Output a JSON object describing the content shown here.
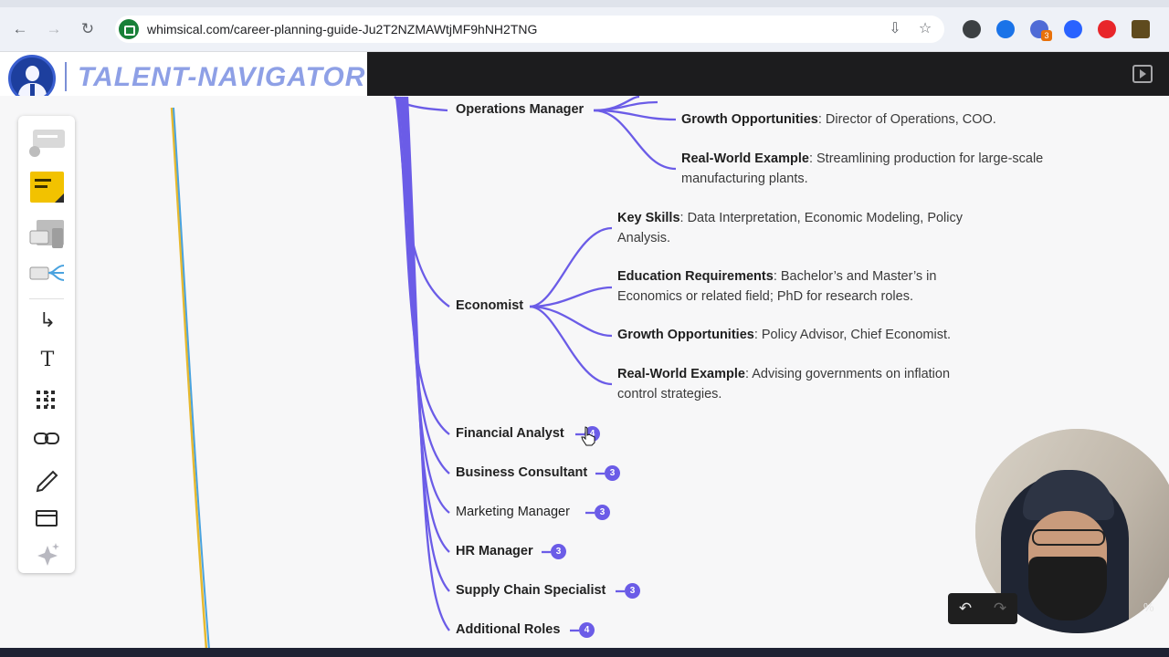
{
  "browser": {
    "url": "whimsical.com/career-planning-guide-Ju2T2NZMAWtjMF9hNH2TNG",
    "back_icon": "arrow-left-icon",
    "forward_icon": "arrow-right-icon",
    "reload_icon": "reload-icon",
    "extension_badge": "3"
  },
  "logo": {
    "text": "TALENT-NAVIGATOR"
  },
  "mindmap": {
    "nodes": [
      {
        "label": "Operations Manager"
      },
      {
        "label": "Economist"
      },
      {
        "label": "Financial Analyst",
        "count": "4"
      },
      {
        "label": "Business Consultant",
        "count": "3"
      },
      {
        "label": "Marketing Manager",
        "count": "3"
      },
      {
        "label": "HR Manager",
        "count": "3"
      },
      {
        "label": "Supply Chain Specialist",
        "count": "3"
      },
      {
        "label": "Additional Roles",
        "count": "4"
      }
    ],
    "operations_leaves": [
      {
        "key": "Growth Opportunities",
        "text": ": Director of Operations, COO."
      },
      {
        "key": "Real-World Example",
        "text": ": Streamlining production for large-scale manufacturing plants."
      }
    ],
    "economist_leaves": [
      {
        "key": "Key Skills",
        "text": ": Data Interpretation, Economic Modeling, Policy Analysis."
      },
      {
        "key": "Education Requirements",
        "text": ": Bachelor’s and Master’s in Economics or related field; PhD for research roles."
      },
      {
        "key": "Growth Opportunities",
        "text": ": Policy Advisor, Chief Economist."
      },
      {
        "key": "Real-World Example",
        "text": ": Advising governments on inflation control strategies."
      }
    ]
  },
  "zoom_fragment": "%",
  "colors": {
    "branch": "#6b5ce7",
    "left_line_yellow": "#e7b92f",
    "left_line_blue": "#4aa3df"
  }
}
